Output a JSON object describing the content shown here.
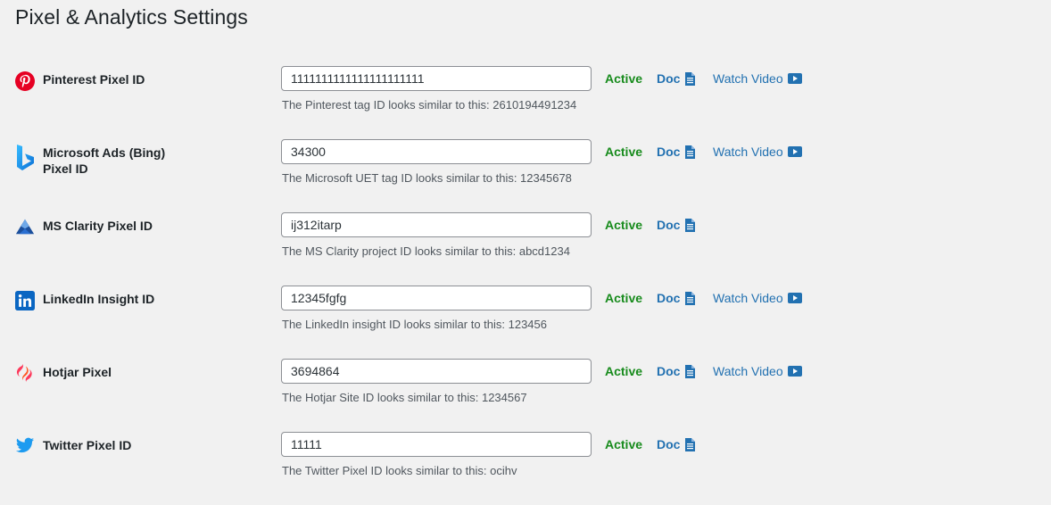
{
  "page": {
    "title": "Pixel & Analytics Settings"
  },
  "colors": {
    "status_active": "#178b1c",
    "link": "#2271b1",
    "text": "#1d2327",
    "hint": "#50575e"
  },
  "pixels": [
    {
      "label": "Pinterest Pixel ID",
      "icon": "pinterest-icon",
      "value": "1111111111111111111111",
      "status": "Active",
      "doc": "Doc",
      "video": "Watch Video",
      "hint": "The Pinterest tag ID looks similar to this: 2610194491234"
    },
    {
      "label": "Microsoft Ads (Bing) Pixel ID",
      "icon": "bing-icon",
      "value": "34300",
      "status": "Active",
      "doc": "Doc",
      "video": "Watch Video",
      "hint": "The Microsoft UET tag ID looks similar to this: 12345678"
    },
    {
      "label": "MS Clarity Pixel ID",
      "icon": "clarity-icon",
      "value": "ij312itarp",
      "status": "Active",
      "doc": "Doc",
      "hint": "The MS Clarity project ID looks similar to this: abcd1234"
    },
    {
      "label": "LinkedIn Insight ID",
      "icon": "linkedin-icon",
      "value": "12345fgfg",
      "status": "Active",
      "doc": "Doc",
      "video": "Watch Video",
      "hint": "The LinkedIn insight ID looks similar to this: 123456"
    },
    {
      "label": "Hotjar Pixel",
      "icon": "hotjar-icon",
      "value": "3694864",
      "status": "Active",
      "doc": "Doc",
      "video": "Watch Video",
      "hint": "The Hotjar Site ID looks similar to this: 1234567"
    },
    {
      "label": "Twitter Pixel ID",
      "icon": "twitter-icon",
      "value": "11111",
      "status": "Active",
      "doc": "Doc",
      "hint": "The Twitter Pixel ID looks similar to this: ocihv"
    }
  ]
}
